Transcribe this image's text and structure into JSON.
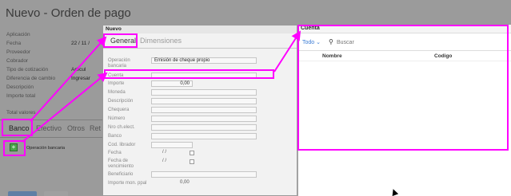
{
  "background_form": {
    "title": "Nuevo - Orden de pago",
    "fields": [
      {
        "label": "Aplicación",
        "value": ""
      },
      {
        "label": "Fecha",
        "value": "22 / 11 /"
      },
      {
        "label": "Proveedor",
        "value": ""
      },
      {
        "label": "Cobrador",
        "value": ""
      },
      {
        "label": "Tipo de cotización",
        "value": "Artícul"
      },
      {
        "label": "Diferencia de cambio",
        "value": "Ingresar"
      },
      {
        "label": "Descripción",
        "value": ""
      },
      {
        "label": "Importe total",
        "value": ""
      }
    ],
    "total_label": "Total valores",
    "tabs": [
      "Banco",
      "Efectivo",
      "Otros",
      "Ret"
    ],
    "add_icon": "plus-icon",
    "column_label": "Operación bancaria"
  },
  "middle_dialog": {
    "title": "Nuevo",
    "tabs": [
      "General",
      "Dimensiones"
    ],
    "fields": [
      {
        "label": "Operación bancaria",
        "value": "Emisión de cheque propio"
      },
      {
        "label": "Cuenta",
        "value": ""
      },
      {
        "label": "Importe",
        "value": "0,00"
      },
      {
        "label": "Moneda",
        "value": ""
      },
      {
        "label": "Descripción",
        "value": ""
      },
      {
        "label": "Chequera",
        "value": ""
      },
      {
        "label": "Número",
        "value": ""
      },
      {
        "label": "Nro ch.elect.",
        "value": ""
      },
      {
        "label": "Banco",
        "value": ""
      },
      {
        "label": "Cod. librador",
        "value": ""
      },
      {
        "label": "Fecha",
        "value": "/ /"
      },
      {
        "label": "Fecha de vencimiento",
        "value": "/ /"
      },
      {
        "label": "Beneficiario",
        "value": ""
      },
      {
        "label": "Importe mon. ppal",
        "value": "0,00"
      }
    ]
  },
  "right_dialog": {
    "title": "Cuenta",
    "filter_label": "Todo",
    "filter_icon": "chevron-down-icon",
    "search_icon": "search-icon",
    "search_placeholder": "Buscar",
    "columns": [
      "Nombre",
      "Codigo"
    ]
  },
  "annotation_color": "#ff00ff"
}
